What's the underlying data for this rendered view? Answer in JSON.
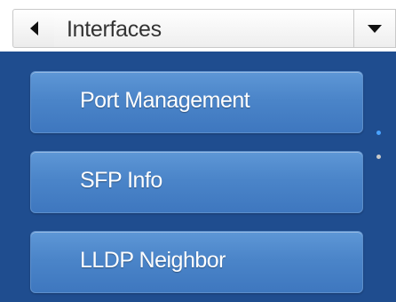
{
  "header": {
    "back_icon": "triangle-left-icon",
    "dropdown": {
      "selected": "Interfaces",
      "arrow_icon": "triangle-down-icon"
    }
  },
  "menu": {
    "items": [
      {
        "label": "Port Management"
      },
      {
        "label": "SFP Info"
      },
      {
        "label": "LLDP Neighbor"
      }
    ]
  },
  "pager": {
    "pages": 2,
    "active_page": 1,
    "colors": {
      "active": "#4aa3ff",
      "inactive": "#c9c9c9"
    }
  },
  "colors": {
    "panel_background": "#1f4d8f",
    "button_top": "#5e97d6",
    "button_bottom": "#3e77bf",
    "button_text": "#ffffff"
  }
}
